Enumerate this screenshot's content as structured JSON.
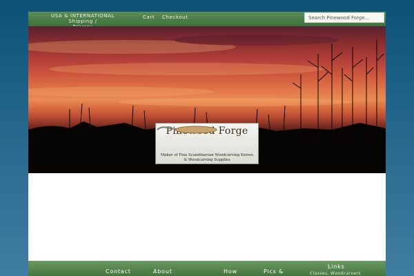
{
  "topnav": {
    "shipping_line1": "USA & INTERNATIONAL Shipping /",
    "shipping_line2": "Privacy",
    "cart": "Cart",
    "checkout": "Checkout"
  },
  "search": {
    "placeholder": "Search Pinewood Forge..."
  },
  "logo": {
    "title": "Pinewood Forge",
    "tagline_line1": "Maker of Fine Scandinavian Woodcarving Knives",
    "tagline_line2": "& Woodcarving Supplies"
  },
  "bottomnav": {
    "contact": "Contact",
    "about": "About",
    "how": "How",
    "pics": "Pics &",
    "links": "Links",
    "links_sub": "Classes, Woodcarvers"
  },
  "colors": {
    "background": "#0c5278",
    "nav_green": "#4a7a45",
    "sky_orange": "#e2784a"
  }
}
